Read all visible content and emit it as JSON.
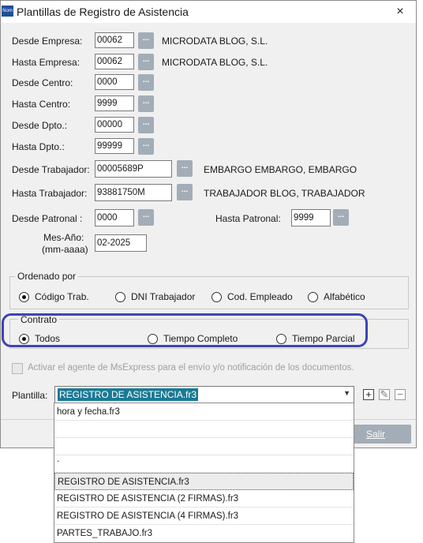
{
  "window": {
    "icon_text": "Nom",
    "title": "Plantillas de Registro de Asistencia",
    "close": "×"
  },
  "fields": {
    "desde_empresa": {
      "label": "Desde Empresa:",
      "value": "00062",
      "desc": "MICRODATA BLOG, S.L."
    },
    "hasta_empresa": {
      "label": "Hasta Empresa:",
      "value": "00062",
      "desc": "MICRODATA BLOG, S.L."
    },
    "desde_centro": {
      "label": "Desde Centro:",
      "value": "0000"
    },
    "hasta_centro": {
      "label": "Hasta Centro:",
      "value": "9999"
    },
    "desde_dpto": {
      "label": "Desde Dpto.:",
      "value": "00000"
    },
    "hasta_dpto": {
      "label": "Hasta Dpto.:",
      "value": "99999"
    },
    "desde_trabajador": {
      "label": "Desde Trabajador:",
      "value": "00005689P",
      "desc": "EMBARGO EMBARGO, EMBARGO"
    },
    "hasta_trabajador": {
      "label": "Hasta Trabajador:",
      "value": "93881750M",
      "desc": "TRABAJADOR BLOG, TRABAJADOR"
    },
    "desde_patronal": {
      "label": "Desde Patronal :",
      "value": "0000"
    },
    "hasta_patronal": {
      "label": "Hasta Patronal:",
      "value": "9999"
    },
    "mes_anio": {
      "label": "Mes-Año:",
      "label2": "(mm-aaaa)",
      "value": "02-2025"
    }
  },
  "lookup_button": "...",
  "ordenado": {
    "legend": "Ordenado por",
    "options": [
      "Código Trab.",
      "DNI Trabajador",
      "Cod. Empleado",
      "Alfabético"
    ],
    "selected": 0
  },
  "contrato": {
    "legend": "Contrato",
    "options": [
      "Todos",
      "Tiempo Completo",
      "Tiempo Parcial"
    ],
    "selected": 0
  },
  "msexpress_check": {
    "label": "Activar el agente de MsExpress para el envío y/o notificación de los documentos.",
    "checked": false
  },
  "plantilla": {
    "label": "Plantilla:",
    "selected": "REGISTRO DE ASISTENCIA.fr3",
    "arrow": "▼",
    "add": "+",
    "edit": "✎",
    "remove": "−"
  },
  "dropdown_items": [
    "hora y fecha.fr3",
    "",
    "",
    ".",
    "REGISTRO DE ASISTENCIA.fr3",
    "REGISTRO DE ASISTENCIA (2 FIRMAS).fr3",
    "REGISTRO DE ASISTENCIA (4 FIRMAS).fr3",
    "PARTES_TRABAJO.fr3"
  ],
  "buttons": {
    "salir": "Salir"
  },
  "colors": {
    "accent": "#1a7a95",
    "lookup": "#a3adb7",
    "annotation": "#3c45b5"
  }
}
